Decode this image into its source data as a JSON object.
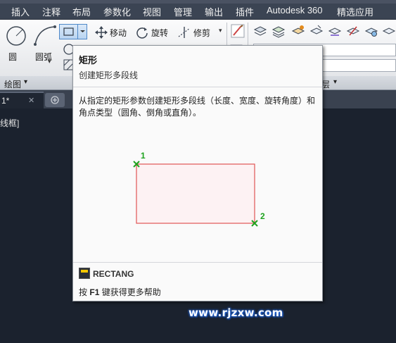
{
  "menu": {
    "items": [
      "插入",
      "注释",
      "布局",
      "参数化",
      "视图",
      "管理",
      "输出",
      "插件",
      "Autodesk 360",
      "精选应用"
    ]
  },
  "ribbon": {
    "draw_tools": {
      "circle_label": "圆",
      "arc_label": "圆弧"
    },
    "modify_tools": {
      "move_label": "移动",
      "rotate_label": "旋转",
      "trim_label": "修剪"
    },
    "panels": {
      "draw_title": "绘图",
      "layers_title": "层"
    }
  },
  "tabs": {
    "doc_tab_label": "1*",
    "close_symbol": "✕"
  },
  "viewport": {
    "label": "线框]"
  },
  "tooltip": {
    "title": "矩形",
    "subtitle": "创建矩形多段线",
    "description": "从指定的矩形参数创建矩形多段线（长度、宽度、旋转角度）和角点类型（圆角、倒角或直角）。",
    "point1_label": "1",
    "point2_label": "2",
    "command": "RECTANG",
    "help_prefix": "按",
    "help_key": "F1",
    "help_suffix": "键获得更多帮助"
  },
  "watermark": "www.rjzxw.com",
  "colors": {
    "menubar": "#3b4453",
    "ribbon": "#f0f1f3",
    "rect_outline": "#e05555",
    "point_marker": "#1fa31f",
    "workspace": "#1b222e"
  }
}
